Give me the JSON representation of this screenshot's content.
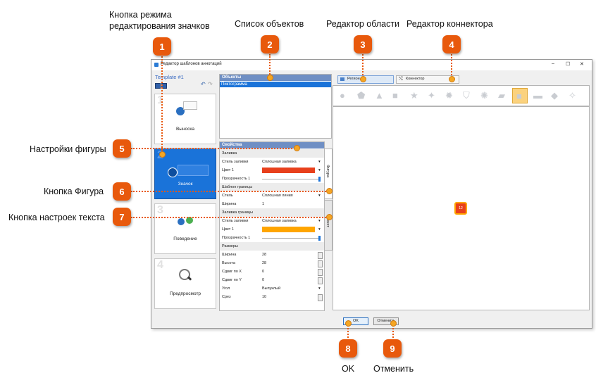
{
  "callouts": {
    "c1": "Кнопка режима редактирования значков",
    "c2": "Список объектов",
    "c3": "Редактор области",
    "c4": "Редактор коннектора",
    "c5": "Настройки фигуры",
    "c6": "Кнопка Фигура",
    "c7": "Кнопка настроек текста",
    "c8": "OK",
    "c9": "Отменить"
  },
  "badges": [
    "1",
    "2",
    "3",
    "4",
    "5",
    "6",
    "7",
    "8",
    "9"
  ],
  "window": {
    "title": "Редактор шаблонов аннотаций",
    "min": "–",
    "max": "☐",
    "close": "✕"
  },
  "template": {
    "name": "Template #1",
    "items": [
      {
        "num": "1",
        "label": "Выноска"
      },
      {
        "num": "2",
        "label": "Значок"
      },
      {
        "num": "3",
        "label": "Поведение"
      },
      {
        "num": "4",
        "label": "Предпросмотр"
      }
    ]
  },
  "objects": {
    "header": "Объекты",
    "items": [
      "Пиктограмма"
    ]
  },
  "properties": {
    "header": "Свойства",
    "fill_section": "Заливка",
    "fill_style_label": "Стиль заливки",
    "fill_style_value": "Сплошная заливка",
    "color1_label": "Цвет 1",
    "opacity_label": "Прозрачность 1",
    "border_section": "Шаблон границы",
    "border_style_label": "Стиль",
    "border_style_value": "Сплошная линия",
    "width_label": "Ширина",
    "width_value": "1",
    "border_fill_section": "Заливка границы",
    "border_fill_style_label": "Стиль заливки",
    "border_fill_style_value": "Сплошная заливка",
    "border_color1_label": "Цвет 1",
    "border_opacity_label": "Прозрачность 1",
    "size_section": "Размеры",
    "size_width_label": "Ширина",
    "size_width_value": "28",
    "size_height_label": "Высота",
    "size_height_value": "28",
    "offset_x_label": "Сдвиг по X",
    "offset_x_value": "0",
    "offset_y_label": "Сдвиг по Y",
    "offset_y_value": "0",
    "angle_label": "Угол",
    "angle_value": "Выпуклый",
    "cut_label": "Срез",
    "cut_value": "10",
    "tab_shape": "Фигура",
    "tab_text": "Текст"
  },
  "colors": {
    "fill_color": "#e8401c",
    "border_color": "#ffa500",
    "accent": "#e8590c",
    "selected": "#1a73d9"
  },
  "editor": {
    "tab_region": "Регион",
    "tab_connector": "Коннектор",
    "preview_badge": "12",
    "shapes": [
      "circle-icon",
      "pentagon-icon",
      "triangle-icon",
      "square-icon",
      "star5-icon",
      "star4-icon",
      "gear-shape-icon",
      "bucket-icon",
      "burst-icon",
      "parallelogram-icon",
      "rounded-square-icon",
      "rounded-rect-icon",
      "diamond-icon",
      "cross-star-icon"
    ]
  },
  "buttons": {
    "ok": "OK",
    "cancel": "Отменить"
  }
}
